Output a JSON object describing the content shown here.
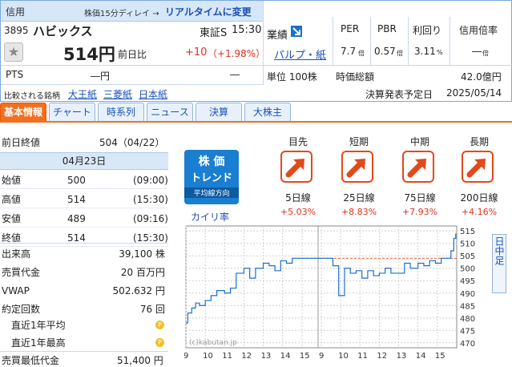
{
  "header": {
    "credit": "信用",
    "delay_note": "株価15分ディレイ →",
    "realtime_link": "リアルタイムに変更"
  },
  "stock": {
    "code": "3895",
    "name": "ハビックス",
    "market": "東証S",
    "time": "15:30",
    "price": "514円",
    "change_label": "前日比",
    "change": "+10",
    "change_pct": "（+1.98%）",
    "pts_label": "PTS",
    "pts_value": "―円",
    "pts_change": "―",
    "compare_label": "比較される銘柄",
    "compare": [
      "大王紙",
      "三菱紙",
      "日本紙"
    ]
  },
  "industry": {
    "label": "業績",
    "sector": "パルプ・紙",
    "unit": "単位 100株"
  },
  "metrics": {
    "headers": [
      "PER",
      "PBR",
      "利回り",
      "信用倍率"
    ],
    "values": [
      "7.7",
      "0.57",
      "3.11",
      "―"
    ],
    "units": [
      "倍",
      "倍",
      "%",
      "倍"
    ],
    "market_cap_label": "時価総額",
    "market_cap": "42.0億円",
    "earnings_label": "決算発表予定日",
    "earnings_date": "2025/05/14"
  },
  "tabs": [
    "基本情報",
    "チャート",
    "時系列",
    "ニュース",
    "決算",
    "大株主"
  ],
  "left": {
    "prev_close_label": "前日終値",
    "prev_close": "504（04/22）",
    "date": "04月23日",
    "ohlc": [
      {
        "label": "始値",
        "value": "500",
        "time": "(09:00)"
      },
      {
        "label": "高値",
        "value": "514",
        "time": "(15:30)"
      },
      {
        "label": "安値",
        "value": "489",
        "time": "(09:16)"
      },
      {
        "label": "終値",
        "value": "514",
        "time": "(15:30)"
      }
    ],
    "stats": [
      {
        "label": "出来高",
        "value": "39,100 株"
      },
      {
        "label": "売買代金",
        "value": "20 百万円"
      },
      {
        "label": "VWAP",
        "value": "502.632 円"
      },
      {
        "label": "約定回数",
        "value": "76 回"
      }
    ],
    "year_avg": "直近1年平均",
    "year_high": "直近1年最高",
    "min_buy_label": "売買最低代金",
    "min_buy": "51,400 円"
  },
  "trend": {
    "badge_title1": "株 価",
    "badge_title2": "トレンド",
    "badge_sub": "平均線方向",
    "kairi": "カイリ率",
    "items": [
      {
        "head": "目先",
        "label": "5日線",
        "pct": "+5.03%"
      },
      {
        "head": "短期",
        "label": "25日線",
        "pct": "+8.83%"
      },
      {
        "head": "中期",
        "label": "75日線",
        "pct": "+7.93%"
      },
      {
        "head": "長期",
        "label": "200日線",
        "pct": "+4.16%"
      }
    ]
  },
  "chart_data": {
    "type": "line",
    "yticks": [
      470,
      475,
      480,
      485,
      490,
      495,
      500,
      505,
      510,
      515
    ],
    "xticks": [
      "9",
      "10",
      "11",
      "12",
      "13",
      "14",
      "15",
      "9",
      "10",
      "11",
      "12",
      "13",
      "14",
      "15"
    ],
    "ylim": [
      468,
      517
    ],
    "prev_close": 504,
    "watermark": "(c)kabutan.jp",
    "side_label": "日中足",
    "series": [
      {
        "x": [
          0,
          0.1,
          0.3,
          0.5,
          0.7,
          1.0,
          1.3,
          1.6,
          2.0,
          2.3,
          2.6,
          3.0,
          3.3,
          3.6,
          4.0,
          4.3,
          4.6,
          4.9,
          5.2,
          5.5,
          5.8,
          6.0,
          6.6,
          7.0,
          7.3,
          7.6,
          7.9,
          8.2,
          8.5,
          8.8,
          9.1,
          9.4,
          9.7,
          10.0,
          10.3,
          10.6,
          11.0,
          11.3,
          11.6,
          12.0,
          12.3,
          12.6,
          12.9,
          13.2,
          13.5,
          13.7,
          13.85,
          13.95
        ],
        "y": [
          478,
          482,
          484,
          486,
          485,
          487,
          489,
          491,
          490,
          492,
          498,
          500,
          496,
          500,
          502,
          501,
          499,
          503,
          502,
          504,
          504,
          504,
          504,
          504,
          504,
          501,
          489,
          500,
          498,
          499,
          496,
          499,
          497,
          498,
          500,
          498,
          498,
          502,
          500,
          502,
          501,
          503,
          502,
          504,
          504,
          507,
          512,
          514
        ]
      }
    ]
  }
}
